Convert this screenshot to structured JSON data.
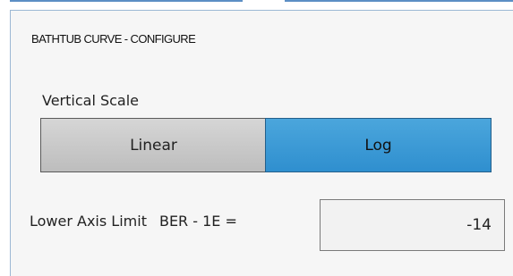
{
  "dialog": {
    "title": "BATHTUB CURVE - CONFIGURE"
  },
  "vertical_scale": {
    "label": "Vertical Scale",
    "options": [
      "Linear",
      "Log"
    ],
    "selected": "Log"
  },
  "lower_axis_limit": {
    "label": "Lower Axis Limit",
    "prefix": "BER - 1E =",
    "value": "-14"
  },
  "colors": {
    "accent": "#3a9ad6",
    "selected_segment": "#3a9ad6",
    "unselected_segment": "#c8c8c8",
    "panel_border": "#5c8fc4"
  }
}
